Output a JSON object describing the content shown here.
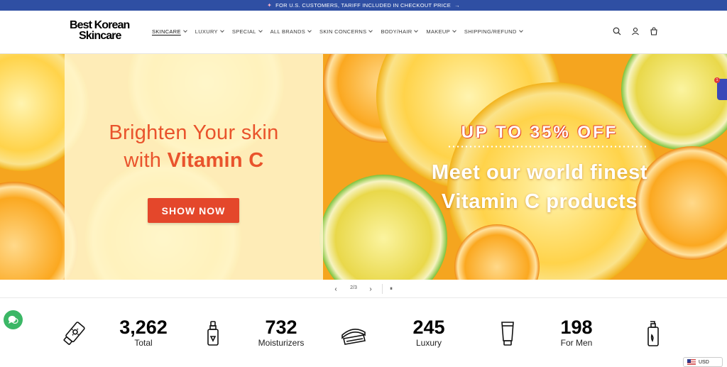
{
  "announcement": {
    "icon": "sparkle-icon",
    "text": "FOR U.S. CUSTOMERS, TARIFF INCLUDED IN CHECKOUT PRICE",
    "arrow": "→"
  },
  "header": {
    "logo_line1": "Best Korean",
    "logo_line2": "Skincare",
    "nav": [
      {
        "label": "SKINCARE",
        "active": true
      },
      {
        "label": "LUXURY"
      },
      {
        "label": "SPECIAL"
      },
      {
        "label": "ALL BRANDS"
      },
      {
        "label": "SKIN CONCERNS"
      },
      {
        "label": "BODY/HAIR"
      },
      {
        "label": "MAKEUP"
      },
      {
        "label": "SHIPPING/REFUND"
      }
    ],
    "icons": [
      "search-icon",
      "account-icon",
      "cart-icon"
    ]
  },
  "hero": {
    "headline_line1": "Brighten Your skin",
    "headline_prefix": "with ",
    "headline_bold": "Vitamin C",
    "button": "SHOW NOW",
    "promo": "UP TO 35% OFF",
    "tagline_line1": "Meet our world finest",
    "tagline_line2": "Vitamin C products",
    "side_badge": "1"
  },
  "slider": {
    "counter": "2/3",
    "prev": "‹",
    "next": "›",
    "pause": "⏸"
  },
  "stats": [
    {
      "number": "3,262",
      "label": "Total",
      "icon": "sunscreen-tube-icon"
    },
    {
      "number": "732",
      "label": "Moisturizers",
      "icon": "serum-bottle-icon"
    },
    {
      "number": "245",
      "label": "Luxury",
      "icon": "cream-jar-icon"
    },
    {
      "number": "198",
      "label": "For Men",
      "icon": "cleanser-tube-icon"
    }
  ],
  "currency": "USD",
  "colors": {
    "announcement_bg": "#2f4fa3",
    "accent": "#e4472b",
    "chat": "#3bb766"
  }
}
